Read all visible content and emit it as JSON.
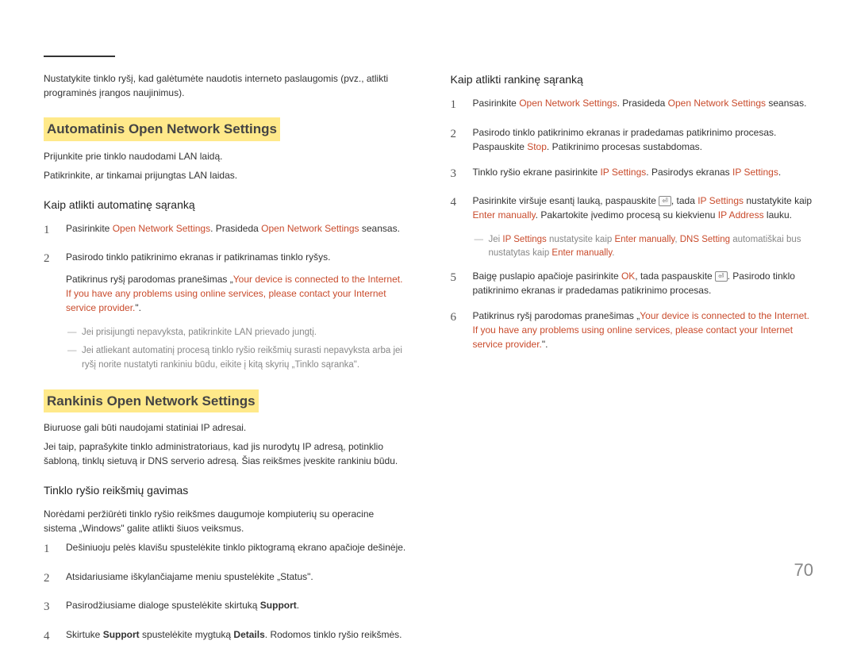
{
  "pageNumber": "70",
  "left": {
    "intro": "Nustatykite tinklo ryšį, kad galėtumėte naudotis interneto paslaugomis (pvz., atlikti programinės įrangos naujinimus).",
    "h2a": "Automatinis Open Network Settings",
    "p1": "Prijunkite prie tinklo naudodami LAN laidą.",
    "p2": "Patikrinkite, ar tinkamai prijungtas LAN laidas.",
    "h3a": "Kaip atlikti automatinę sąranką",
    "s1": {
      "a": "Pasirinkite ",
      "b": "Open Network Settings",
      "c": ". Prasideda ",
      "d": "Open Network Settings",
      "e": " seansas."
    },
    "s2": "Pasirodo tinklo patikrinimo ekranas ir patikrinamas tinklo ryšys.",
    "s2_sub": {
      "a": "Patikrinus ryšį parodomas pranešimas „",
      "b": "Your device is connected to the Internet. If you have any problems using online services, please contact your Internet service provider.",
      "c": "\"."
    },
    "n1": "Jei prisijungti nepavyksta, patikrinkite LAN prievado jungtį.",
    "n2": "Jei atliekant automatinį procesą tinklo ryšio reikšmių surasti nepavyksta arba jei ryšį norite nustatyti rankiniu būdu, eikite į kitą skyrių „Tinklo sąranka\".",
    "h2b": "Rankinis Open Network Settings",
    "p3": "Biuruose gali būti naudojami statiniai IP adresai.",
    "p4": "Jei taip, paprašykite tinklo administratoriaus, kad jis nurodytų IP adresą, potinklio šabloną, tinklų sietuvą ir DNS serverio adresą. Šias reikšmes įveskite rankiniu būdu.",
    "h3b": "Tinklo ryšio reikšmių gavimas",
    "p5": "Norėdami peržiūrėti tinklo ryšio reikšmes daugumoje kompiuterių su operacine sistema „Windows\" galite atlikti šiuos veiksmus.",
    "b1": "Dešiniuoju pelės klavišu spustelėkite tinklo piktogramą ekrano apačioje dešinėje.",
    "b2": "Atsidariusiame iškylančiajame meniu spustelėkite „Status\".",
    "b3": {
      "a": "Pasirodžiusiame dialoge spustelėkite skirtuką ",
      "b": "Support",
      "c": "."
    },
    "b4": {
      "a": "Skirtuke ",
      "b": "Support",
      "c": " spustelėkite mygtuką ",
      "d": "Details",
      "e": ". Rodomos tinklo ryšio reikšmės."
    }
  },
  "right": {
    "h3": "Kaip atlikti rankinę sąranką",
    "r1": {
      "a": "Pasirinkite ",
      "b": "Open Network Settings",
      "c": ". Prasideda ",
      "d": "Open Network Settings",
      "e": " seansas."
    },
    "r2": {
      "a": "Pasirodo tinklo patikrinimo ekranas ir pradedamas patikrinimo procesas. Paspauskite ",
      "b": "Stop",
      "c": ". Patikrinimo procesas sustabdomas."
    },
    "r3": {
      "a": "Tinklo ryšio ekrane pasirinkite ",
      "b": "IP Settings",
      "c": ". Pasirodys ekranas ",
      "d": "IP Settings",
      "e": "."
    },
    "r4": {
      "a": "Pasirinkite viršuje esantį lauką, paspauskite ",
      "k1": "⏎",
      "b": ", tada ",
      "c": "IP Settings",
      "d": " nustatykite kaip ",
      "e": "Enter manually",
      "f": ". Pakartokite įvedimo procesą su kiekvienu ",
      "g": "IP Address",
      "h": " lauku."
    },
    "note": {
      "a": "Jei ",
      "b": "IP Settings",
      "c": " nustatysite kaip ",
      "d": "Enter manually",
      "e": ", ",
      "f": "DNS Setting",
      "g": " automatiškai bus nustatytas kaip ",
      "h": "Enter manually",
      "i": "."
    },
    "r5": {
      "a": "Baigę puslapio apačioje pasirinkite ",
      "b": "OK",
      "c": ", tada paspauskite ",
      "k1": "⏎",
      "d": ". Pasirodo tinklo patikrinimo ekranas ir pradedamas patikrinimo procesas."
    },
    "r6": {
      "a": "Patikrinus ryšį parodomas pranešimas „",
      "b": "Your device is connected to the Internet. If you have any problems using online services, please contact your Internet service provider.",
      "c": "\"."
    }
  }
}
